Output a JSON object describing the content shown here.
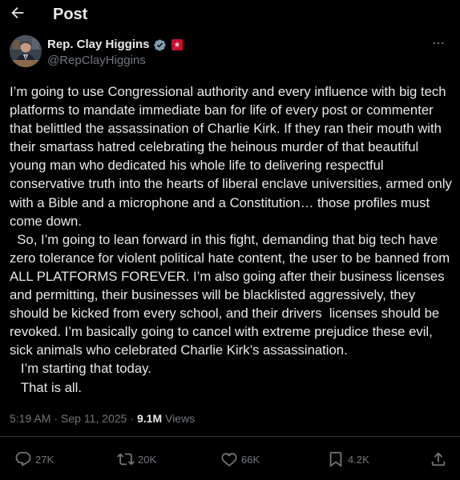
{
  "header": {
    "title": "Post",
    "back_icon": "arrow-left-icon"
  },
  "author": {
    "display_name": "Rep. Clay Higgins",
    "handle": "@RepClayHiggins",
    "verified_icon": "verified-badge-icon",
    "affiliation_icon": "government-affiliation-icon",
    "more_icon": "more-dots-icon"
  },
  "post": {
    "text": "I’m going to use Congressional authority and every influence with big tech platforms to mandate immediate ban for life of every post or commenter that belittled the assassination of Charlie Kirk. If they ran their mouth with their smartass hatred celebrating the heinous murder of that beautiful young man who dedicated his whole life to delivering respectful conservative truth into the hearts of liberal enclave universities, armed only with a Bible and a microphone and a Constitution… those profiles must come down.\n  So, I’m going to lean forward in this fight, demanding that big tech have zero tolerance for violent political hate content, the user to be banned from ALL PLATFORMS FOREVER. I’m also going after their business licenses and permitting, their businesses will be blacklisted aggressively, they should be kicked from every school, and their drivers  licenses should be revoked. I’m basically going to cancel with extreme prejudice these evil, sick animals who celebrated Charlie Kirk’s assassination.\n   I’m starting that today.\n   That is all."
  },
  "meta": {
    "time": "5:19 AM",
    "separator": "·",
    "date": "Sep 11, 2025",
    "views_count": "9.1M",
    "views_label": "Views"
  },
  "actions": {
    "replies": "27K",
    "reposts": "20K",
    "likes": "66K",
    "bookmarks": "4.2K"
  },
  "colors": {
    "background": "#000000",
    "text": "#e7e9ea",
    "muted": "#71767b",
    "divider": "#2f3336",
    "verified": "#829aab",
    "affiliation": "#c8102e"
  }
}
